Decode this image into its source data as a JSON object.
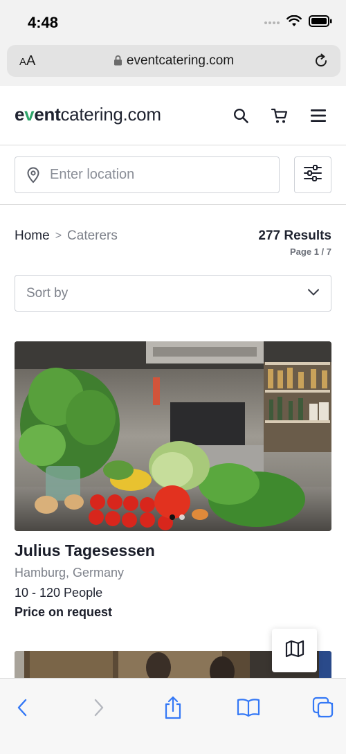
{
  "status_bar": {
    "time": "4:48"
  },
  "browser": {
    "text_size_label_small": "A",
    "text_size_label_large": "A",
    "url": "eventcatering.com"
  },
  "site": {
    "logo": {
      "part1": "e",
      "part2": "v",
      "part3": "ent",
      "part4": "catering.com"
    },
    "location_placeholder": "Enter location",
    "breadcrumb": {
      "home": "Home",
      "separator": ">",
      "current": "Caterers"
    },
    "results": {
      "count": "277 Results",
      "page": "Page 1 / 7"
    },
    "sort": {
      "label": "Sort by"
    }
  },
  "listings": [
    {
      "title": "Julius Tagesessen",
      "location": "Hamburg, Germany",
      "capacity": "10 - 120 People",
      "price": "Price on request",
      "carousel_active_index": 0,
      "carousel_count": 2
    }
  ],
  "icons": {
    "header": [
      "search-icon",
      "cart-icon",
      "menu-icon"
    ],
    "filter": "sliders-icon",
    "map": "map-icon",
    "toolbar": [
      "back-icon",
      "forward-icon",
      "share-icon",
      "bookmarks-icon",
      "tabs-icon"
    ]
  },
  "colors": {
    "brand_accent": "#2fa56a",
    "text_dark": "#1a1d29",
    "text_muted": "#7d818a",
    "border": "#cfd2d8",
    "ios_blue": "#3478f6"
  }
}
